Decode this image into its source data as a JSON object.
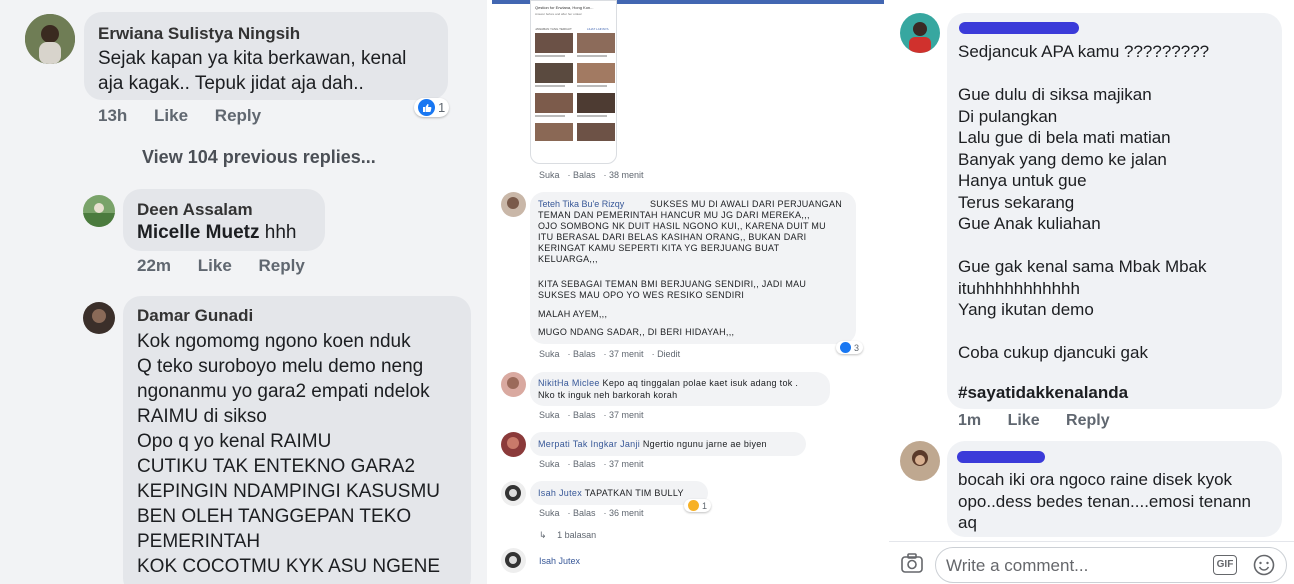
{
  "left": {
    "comment1": {
      "author": "Erwiana Sulistya Ningsih",
      "text": "Sejak kapan ya kita berkawan,  kenal\naja kagak..  Tepuk jidat aja dah..",
      "time": "13h",
      "like": "Like",
      "reply": "Reply",
      "reactions": "1"
    },
    "view_previous": "View 104 previous replies...",
    "comment2": {
      "author": "Deen Assalam",
      "tag": "Micelle Muetz",
      "text": " hhh",
      "time": "22m",
      "like": "Like",
      "reply": "Reply"
    },
    "comment3": {
      "author": "Damar Gunadi",
      "text": "Kok ngomomg ngono koen nduk\nQ teko suroboyo melu demo neng\nngonanmu yo gara2 empati ndelok\nRAIMU di sikso\nOpo q yo kenal RAIMU\nCUTIKU TAK ENTEKNO GARA2\nKEPINGIN NDAMPINGI KASUSMU\nBEN OLEH TANGGEPAN TEKO\nPEMERINTAH\nKOK COCOTMU KYK ASU NGENE"
    }
  },
  "mid": {
    "shared_post": {
      "title": "Qestion for Erwiana, Hong Kon...",
      "subtitle": "Answer before and after her ordeal",
      "tab_left": "JAWABAN YANG TERKAIT",
      "tab_right": "LIHAT LAINNYA"
    },
    "meta0": {
      "like": "Suka",
      "reply": "Balas",
      "time": "38 menit"
    },
    "c1": {
      "author": "Teteh Tika Bu'e Rizqy",
      "text": "SUKSES MU DI AWALI DARI PERJUANGAN\nTEMAN DAN PEMERINTAH HANCUR MU JG DARI MEREKA,,,\nOJO SOMBONG NK DUIT HASIL NGONO KUI,, KARENA DUIT MU\nITU BERASAL DARI BELAS KASIHAN ORANG,, BUKAN DARI\nKERINGAT KAMU SEPERTI KITA YG BERJUANG BUAT\nKELUARGA,,,",
      "text2": "KITA SEBAGAI TEMAN BMI BERJUANG SENDIRI,, JADI MAU\nSUKSES MAU OPO YO WES RESIKO SENDIRI",
      "text3": "MALAH AYEM,,,",
      "text4": "MUGO NDANG SADAR,, DI BERI HIDAYAH,,,",
      "like": "Suka",
      "reply": "Balas",
      "time": "37 menit",
      "edited": "Diedit",
      "reactions": "3"
    },
    "c2": {
      "author": "NikitHa Miclee",
      "text_inline": " Kepo aq tinggalan polae kaet isuk adang tok .",
      "text": "Nko tk inguk neh barkorah korah",
      "like": "Suka",
      "reply": "Balas",
      "time": "37 menit"
    },
    "c3": {
      "author": "Merpati Tak Ingkar Janji",
      "text_inline": " Ngertio ngunu jarne ae biyen",
      "like": "Suka",
      "reply": "Balas",
      "time": "37 menit"
    },
    "c4": {
      "author": "Isah Jutex",
      "text_inline": " TAPATKAN TIM BULLY",
      "like": "Suka",
      "reply": "Balas",
      "time": "36 menit",
      "reactions": "1",
      "replies": "1 balasan"
    },
    "c5": {
      "author": "Isah Jutex"
    }
  },
  "right": {
    "comment1": {
      "text": "Sedjancuk APA kamu ?????????\n\nGue dulu di siksa majikan\nDi pulangkan\nLalu gue di bela mati matian\nBanyak yang demo ke jalan\nHanya untuk gue\nTerus sekarang\nGue Anak kuliahan\n\nGue gak kenal sama Mbak Mbak\nituhhhhhhhhhhh\nYang ikutan demo\n\nCoba cukup djancuki gak",
      "hashtag": "#sayatidakkenalanda",
      "time": "1m",
      "like": "Like",
      "reply": "Reply"
    },
    "comment2": {
      "text": "bocah iki ora ngoco raine disek kyok\nopo..dess bedes tenan....emosi tenann\naq"
    },
    "composer": {
      "placeholder": "Write a comment...",
      "gif": "GIF"
    }
  },
  "colors": {
    "facebook_blue": "#1877f2",
    "link_blue": "#385898",
    "bubble_gray": "#f0f2f5",
    "redaction_blue": "#3b3bd9"
  },
  "icons": [
    "like-icon",
    "haha-icon",
    "camera-icon",
    "gif-icon",
    "emoji-icon",
    "reply-arrow-icon"
  ]
}
